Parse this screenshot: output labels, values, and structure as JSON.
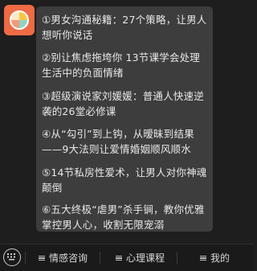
{
  "menu": {
    "items": [
      {
        "label": "①男女沟通秘籍：27个策略，让男人想听你说话"
      },
      {
        "label": "②别让焦虑拖垮你 13节课学会处理生活中的负面情绪"
      },
      {
        "label": "③超级演说家刘媛媛：普通人快速逆袭的26堂必修课"
      },
      {
        "label": "④从“勾引”到上钩，从暧昧到结果——9大法则让爱情婚姻顺风顺水"
      },
      {
        "label": "⑤14节私房性爱术，让男人对你神魂颠倒"
      },
      {
        "label": "⑥五大终极“虐男”杀手锏，教你优雅掌控男人心，收割无限宠溺"
      }
    ]
  },
  "bottom_bar": {
    "tabs": [
      {
        "label": "情感咨询"
      },
      {
        "label": "心理课程"
      },
      {
        "label": "我的"
      }
    ]
  },
  "icons": {
    "avatar": "colorful-disc-logo",
    "keyboard": "keyboard-icon",
    "menu": "hamburger-icon"
  },
  "colors": {
    "background": "#1e1e1e",
    "panel": "#3d3d3d",
    "avatar": "#ee6b45",
    "text": "#e8e8e8"
  }
}
